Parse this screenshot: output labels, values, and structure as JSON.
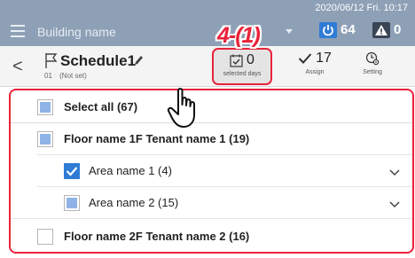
{
  "header": {
    "building_name": "Building name",
    "datetime": "2020/06/12 Fri. 10:17",
    "power_count": "64",
    "alert_count": "0"
  },
  "annotation": {
    "callout": "4-(1)"
  },
  "schedule": {
    "name": "Schedule1",
    "number": "01",
    "status": "(Not set)",
    "back_label": "<",
    "buttons": {
      "selected_days": {
        "count": "0",
        "label": "selected days"
      },
      "assign": {
        "count": "17",
        "label": "Assign"
      },
      "setting": {
        "label": "Setting"
      }
    }
  },
  "list": {
    "select_all": {
      "label": "Select all (67)",
      "state": "partial"
    },
    "floors": [
      {
        "label": "Floor name 1F Tenant name 1 (19)",
        "state": "partial",
        "areas": [
          {
            "label": "Area name 1 (4)",
            "state": "checked"
          },
          {
            "label": "Area name 2 (15)",
            "state": "partial"
          }
        ]
      },
      {
        "label": "Floor name 2F Tenant name 2 (16)",
        "state": "unchecked"
      }
    ]
  },
  "colors": {
    "header_bg": "#8ea0b6",
    "accent": "#2f7bd6",
    "partial": "#8fb3e6",
    "callout_red": "#e8233a"
  },
  "icons": [
    "menu-icon",
    "power-icon",
    "alert-icon",
    "flag-icon",
    "pencil-icon",
    "calendar-check-icon",
    "checkmark-icon",
    "clock-gear-icon",
    "chevron-down-icon",
    "hand-pointer-icon"
  ]
}
